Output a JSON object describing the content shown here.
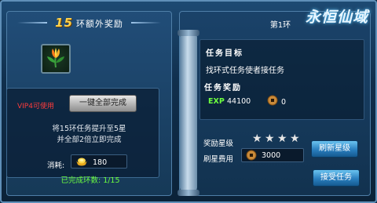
{
  "left": {
    "title_number": "15",
    "title_text": "环额外奖励",
    "vip_label": "VIP4可使用",
    "complete_button": "一键全部完成",
    "desc_line1": "将15环任务提升至5星",
    "desc_line2": "并全部2倍立即完成",
    "cost_label": "消耗:",
    "cost_value": "180",
    "done_count": "已完成环数: 1/15",
    "cost_icon": "gold-ingot-icon",
    "reward_item_icon": "flower-item-icon"
  },
  "right": {
    "ring_tab": "第1环",
    "logo": "永恒仙域",
    "goal_header": "任务目标",
    "goal_text": "找环式任务使者接任务",
    "reward_header": "任务奖励",
    "exp_label": "EXP",
    "exp_value": "44100",
    "coin_reward_value": "0",
    "star_label": "奖励星级",
    "stars": {
      "filled": 4,
      "total": 4
    },
    "refresh_button": "刷新星级",
    "fee_label": "刷星费用",
    "fee_value": "3000",
    "accept_button": "接受任务",
    "coin_icon": "copper-coin-icon"
  },
  "colors": {
    "vip_red": "#ff3b3b",
    "done_green": "#6dff3f",
    "title_gold": "#ffd24a",
    "button_blue": "#2a7fbf"
  }
}
